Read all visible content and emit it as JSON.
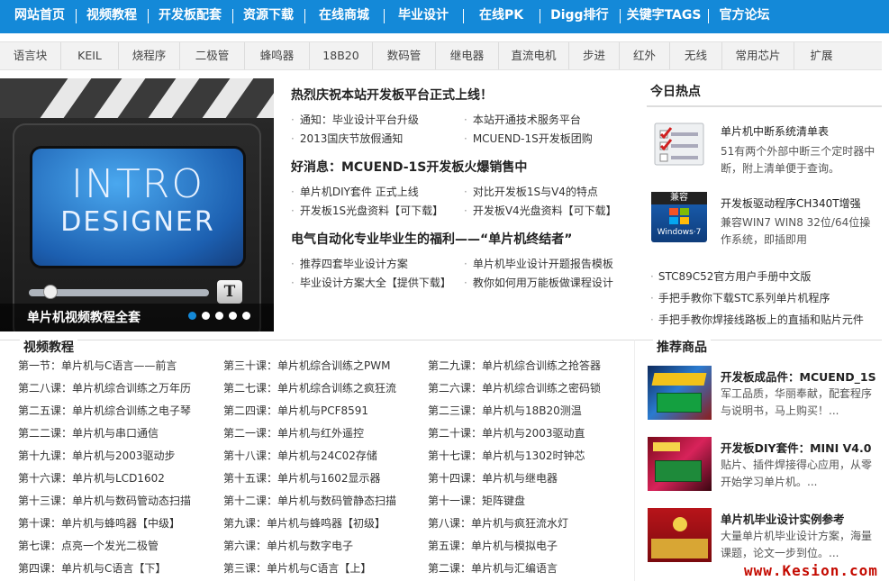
{
  "colors": {
    "nav_bg": "#1489d8",
    "watermark": "#c40a00"
  },
  "top_nav": [
    "网站首页",
    "视频教程",
    "开发板配套",
    "资源下载",
    "在线商城",
    "毕业设计",
    "在线PK",
    "Digg排行",
    "关键字TAGS",
    "官方论坛"
  ],
  "sub_nav": [
    "语言块",
    "KEIL",
    "烧程序",
    "二极管",
    "蜂鸣器",
    "18B20",
    "数码管",
    "继电器",
    "直流电机",
    "步进",
    "红外",
    "无线",
    "常用芯片",
    "扩展"
  ],
  "banner": {
    "screen_line1": "INTRO",
    "screen_line2": "DESIGNER",
    "button_glyph": "T",
    "caption": "单片机视频教程全套",
    "slide_count": 5,
    "active_slide": 1
  },
  "news": {
    "headline1": "热烈庆祝本站开发板平台正式上线！",
    "group1": [
      "通知：毕业设计平台升级",
      "本站开通技术服务平台",
      "2013国庆节放假通知",
      "MCUEND-1S开发板团购"
    ],
    "headline2": "好消息：MCUEND-1S开发板火爆销售中",
    "group2": [
      "单片机DIY套件 正式上线",
      "对比开发板1S与V4的特点",
      "开发板1S光盘资料【可下载】",
      "开发板V4光盘资料【可下载】"
    ],
    "headline3": "电气自动化专业毕业生的福利——“单片机终结者”",
    "group3": [
      "推荐四套毕业设计方案",
      "单片机毕业设计开题报告模板",
      "毕业设计方案大全【提供下载】",
      "教你如何用万能板做课程设计"
    ]
  },
  "hot": {
    "title": "今日热点",
    "items": [
      {
        "icon": "checklist-icon",
        "title": "单片机中断系统清单表",
        "desc": "51有两个外部中断三个定时器中断，附上清单便于查询。"
      },
      {
        "icon": "windows7-icon",
        "badge": "兼容",
        "logo_text": "Windows·7",
        "title": "开发板驱动程序CH340T增强",
        "desc": "兼容WIN7 WIN8 32位/64位操作系统，即插即用"
      }
    ],
    "links": [
      "STC89C52官方用户手册中文版",
      "手把手教你下载STC系列单片机程序",
      "手把手教你焊接线路板上的直插和贴片元件"
    ]
  },
  "video": {
    "title": "视频教程",
    "lessons": [
      "第一节：单片机与C语言——前言",
      "第三十课：单片机综合训练之PWM",
      "第二九课：单片机综合训练之抢答器",
      "第二八课：单片机综合训练之万年历",
      "第二七课：单片机综合训练之疯狂流",
      "第二六课：单片机综合训练之密码锁",
      "第二五课：单片机综合训练之电子琴",
      "第二四课：单片机与PCF8591",
      "第二三课：单片机与18B20测温",
      "第二二课：单片机与串口通信",
      "第二一课：单片机与红外遥控",
      "第二十课：单片机与2003驱动直",
      "第十九课：单片机与2003驱动步",
      "第十八课：单片机与24C02存储",
      "第十七课：单片机与1302时钟芯",
      "第十六课：单片机与LCD1602",
      "第十五课：单片机与1602显示器",
      "第十四课：单片机与继电器",
      "第十三课：单片机与数码管动态扫描",
      "第十二课：单片机与数码管静态扫描",
      "第十一课：矩阵键盘",
      "第十课：单片机与蜂鸣器【中级】",
      "第九课：单片机与蜂鸣器【初级】",
      "第八课：单片机与疯狂流水灯",
      "第七课：点亮一个发光二极管",
      "第六课：单片机与数字电子",
      "第五课：单片机与模拟电子",
      "第四课：单片机与C语言【下】",
      "第三课：单片机与C语言【上】",
      "第二课：单片机与汇编语言"
    ]
  },
  "rec": {
    "title": "推荐商品",
    "items": [
      {
        "title": "开发板成品件：MCUEND_1S",
        "desc": "军工品质，华丽奉献，配套程序与说明书，马上购买！..."
      },
      {
        "title": "开发板DIY套件：MINI V4.0",
        "desc": "贴片、插件焊接得心应用，从零开始学习单片机。..."
      },
      {
        "title": "单片机毕业设计实例参考",
        "desc": "大量单片机毕业设计方案，海量课题，论文一步到位。..."
      }
    ]
  },
  "watermark": "www.Kesion.com"
}
